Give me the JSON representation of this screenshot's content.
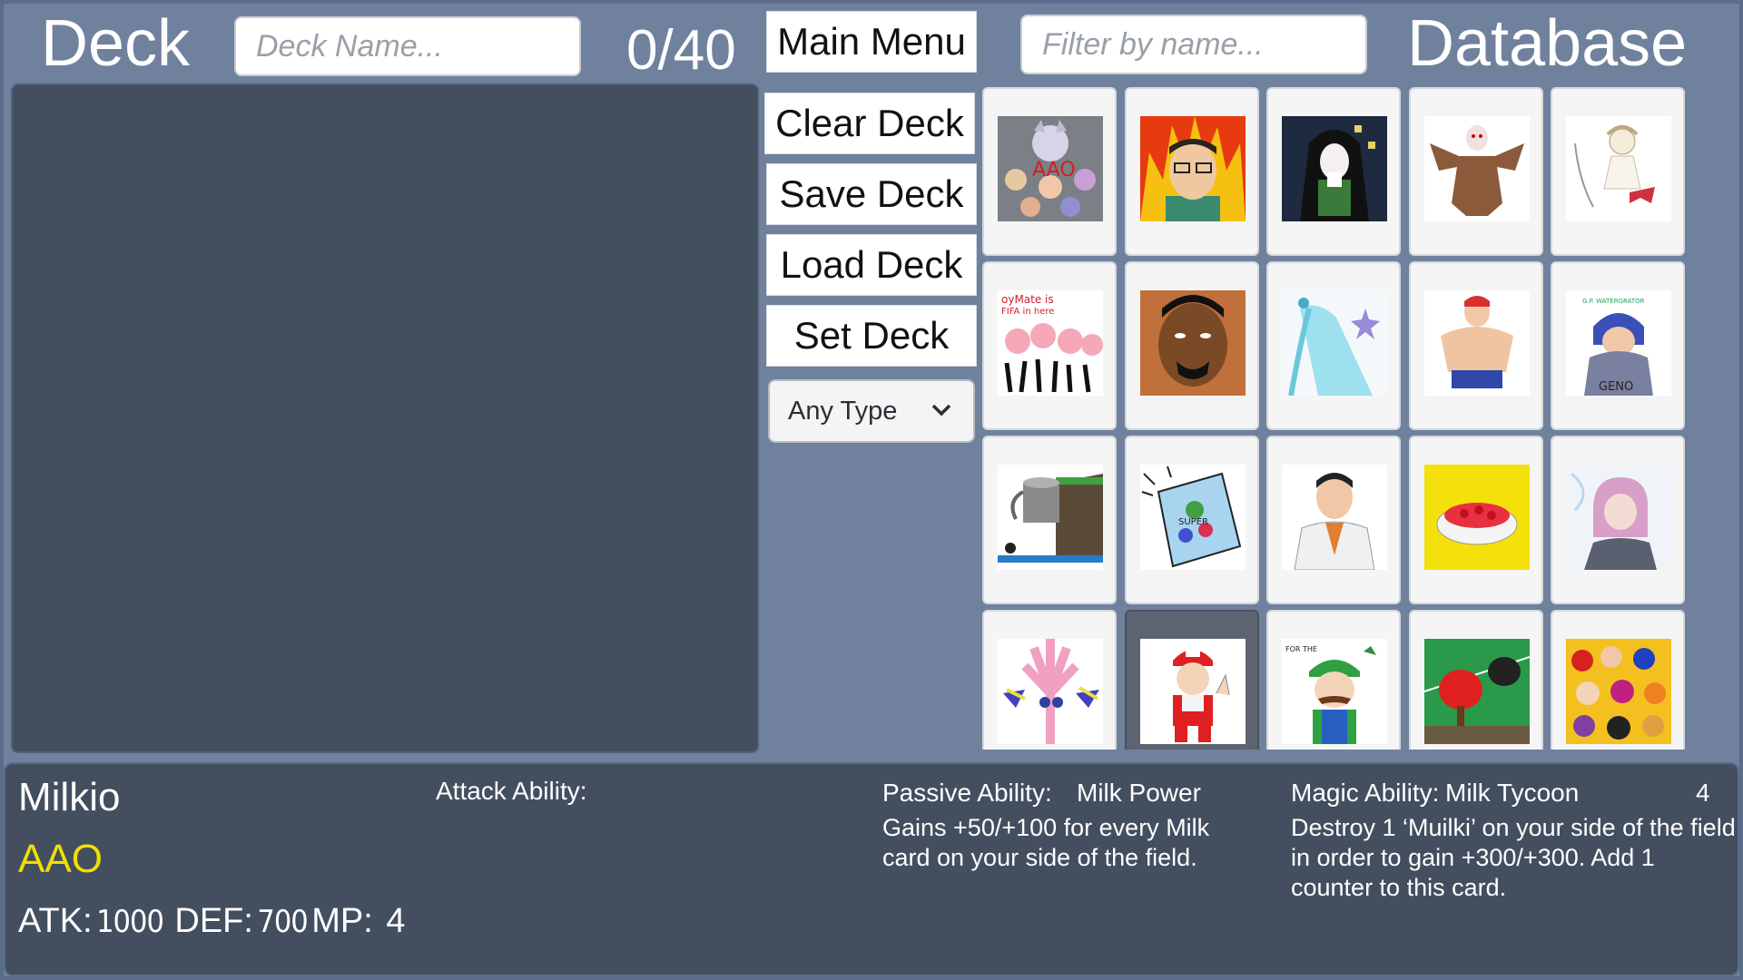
{
  "deck": {
    "title": "Deck",
    "name_placeholder": "Deck Name...",
    "count": "0/40"
  },
  "buttons": {
    "main_menu": "Main Menu",
    "clear_deck": "Clear Deck",
    "save_deck": "Save Deck",
    "load_deck": "Load Deck",
    "set_deck": "Set Deck"
  },
  "type_filter": {
    "selected": "Any Type"
  },
  "database": {
    "title": "Database",
    "filter_placeholder": "Filter by name...",
    "selected_index": 16,
    "cards": [
      {
        "art": "group-crowd-art"
      },
      {
        "art": "flame-man-art"
      },
      {
        "art": "caped-figure-art"
      },
      {
        "art": "brown-creature-art"
      },
      {
        "art": "angel-sketch-art"
      },
      {
        "art": "pink-crowd-art"
      },
      {
        "art": "bearded-man-art"
      },
      {
        "art": "cyan-hair-art"
      },
      {
        "art": "muscle-man-art"
      },
      {
        "art": "hooded-figure-art"
      },
      {
        "art": "bucket-cliff-art"
      },
      {
        "art": "cereal-box-art"
      },
      {
        "art": "white-jacket-man-art"
      },
      {
        "art": "yellow-cake-art"
      },
      {
        "art": "pink-hair-art"
      },
      {
        "art": "pink-plant-art"
      },
      {
        "art": "milk-mascot-art"
      },
      {
        "art": "green-cap-man-art"
      },
      {
        "art": "table-tennis-art"
      },
      {
        "art": "crowd-collage-art"
      }
    ]
  },
  "selected_card": {
    "name": "Milkio",
    "set": "AAO",
    "atk_label": "ATK:",
    "atk": "1000",
    "def_label": "DEF:",
    "def": "700",
    "mp_label": "MP:",
    "mp": "4",
    "attack_ability_label": "Attack Ability:",
    "attack_ability_name": "",
    "passive_ability_label": "Passive Ability:",
    "passive_ability_name": "Milk Power",
    "passive_ability_text": "Gains +50/+100 for every Milk card on your side of the field.",
    "magic_ability_label": "Magic Ability:",
    "magic_ability_name": "Milk Tycoon",
    "magic_ability_cost": "4",
    "magic_ability_text": "Destroy 1 ‘Muilki’ on your side of the field in order to gain +300/+300. Add 1 counter to this card."
  },
  "colors": {
    "background": "#6f819d",
    "panel": "#434e5f",
    "set_text": "#f0e000"
  }
}
